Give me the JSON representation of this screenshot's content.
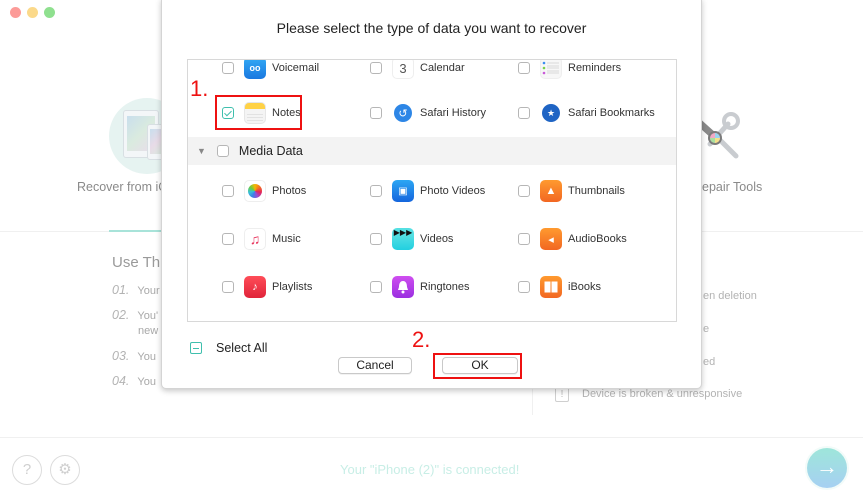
{
  "window": {
    "traffic_lights": [
      "close",
      "minimize",
      "maximize"
    ]
  },
  "background": {
    "modes": [
      {
        "label": "Recover from iCloud",
        "visible_label": "Recover from iC",
        "icon": "ipad-iphone-icon"
      },
      {
        "label": "Repair Tools",
        "visible_label": "epair Tools",
        "icon": "repair-tools-icon"
      }
    ],
    "use_section": {
      "title": "Use Thi",
      "items": [
        {
          "num": "01.",
          "text": "Your"
        },
        {
          "num": "02.",
          "text": "You'",
          "cont": "new"
        },
        {
          "num": "03.",
          "text": "You"
        },
        {
          "num": "04.",
          "text": "You"
        }
      ]
    },
    "right_items": [
      {
        "text": "en deletion"
      },
      {
        "text": "e"
      },
      {
        "text": "ed"
      },
      {
        "text": "Device is broken & unresponsive",
        "icon": "exclamation-icon"
      }
    ],
    "footer": {
      "help_icon": "?",
      "status": "Your \"iPhone (2)\" is connected!",
      "next_icon": "→"
    }
  },
  "dialog": {
    "title": "Please select the type of data you want to recover",
    "rows": [
      [
        {
          "label": "Voicemail",
          "icon": "voicemail-icon",
          "glyph": "oo",
          "checked": false
        },
        {
          "label": "Calendar",
          "icon": "calendar-icon",
          "glyph": "3",
          "checked": false
        },
        {
          "label": "Reminders",
          "icon": "reminders-icon",
          "glyph": "",
          "checked": false
        }
      ],
      [
        {
          "label": "Notes",
          "icon": "notes-icon",
          "glyph": "",
          "checked": true
        },
        {
          "label": "Safari History",
          "icon": "safari-history-icon",
          "glyph": "↺",
          "checked": false
        },
        {
          "label": "Safari Bookmarks",
          "icon": "safari-bookmarks-icon",
          "glyph": "★",
          "checked": false
        }
      ]
    ],
    "section": {
      "label": "Media Data",
      "checked": false,
      "expanded": true
    },
    "media_rows": [
      [
        {
          "label": "Photos",
          "icon": "photos-icon",
          "glyph": "",
          "checked": false
        },
        {
          "label": "Photo Videos",
          "icon": "photo-videos-icon",
          "glyph": "▣",
          "checked": false
        },
        {
          "label": "Thumbnails",
          "icon": "thumbnails-icon",
          "glyph": "▲",
          "checked": false
        }
      ],
      [
        {
          "label": "Music",
          "icon": "music-icon",
          "glyph": "♫",
          "checked": false
        },
        {
          "label": "Videos",
          "icon": "videos-icon",
          "glyph": "▶▶▶",
          "checked": false
        },
        {
          "label": "AudioBooks",
          "icon": "audiobooks-icon",
          "glyph": "◂",
          "checked": false
        }
      ],
      [
        {
          "label": "Playlists",
          "icon": "playlists-icon",
          "glyph": "♪",
          "checked": false
        },
        {
          "label": "Ringtones",
          "icon": "ringtones-icon",
          "glyph": "🔔",
          "checked": false
        },
        {
          "label": "iBooks",
          "icon": "ibooks-icon",
          "glyph": "▯▯",
          "checked": false
        }
      ]
    ],
    "select_all": {
      "label": "Select All",
      "state": "partial"
    },
    "buttons": {
      "cancel": "Cancel",
      "ok": "OK"
    }
  },
  "annotations": [
    {
      "label": "1.",
      "target": "Notes"
    },
    {
      "label": "2.",
      "target": "OK"
    }
  ],
  "colors": {
    "accent": "#3fbfad",
    "annotation": "#ee1111"
  }
}
